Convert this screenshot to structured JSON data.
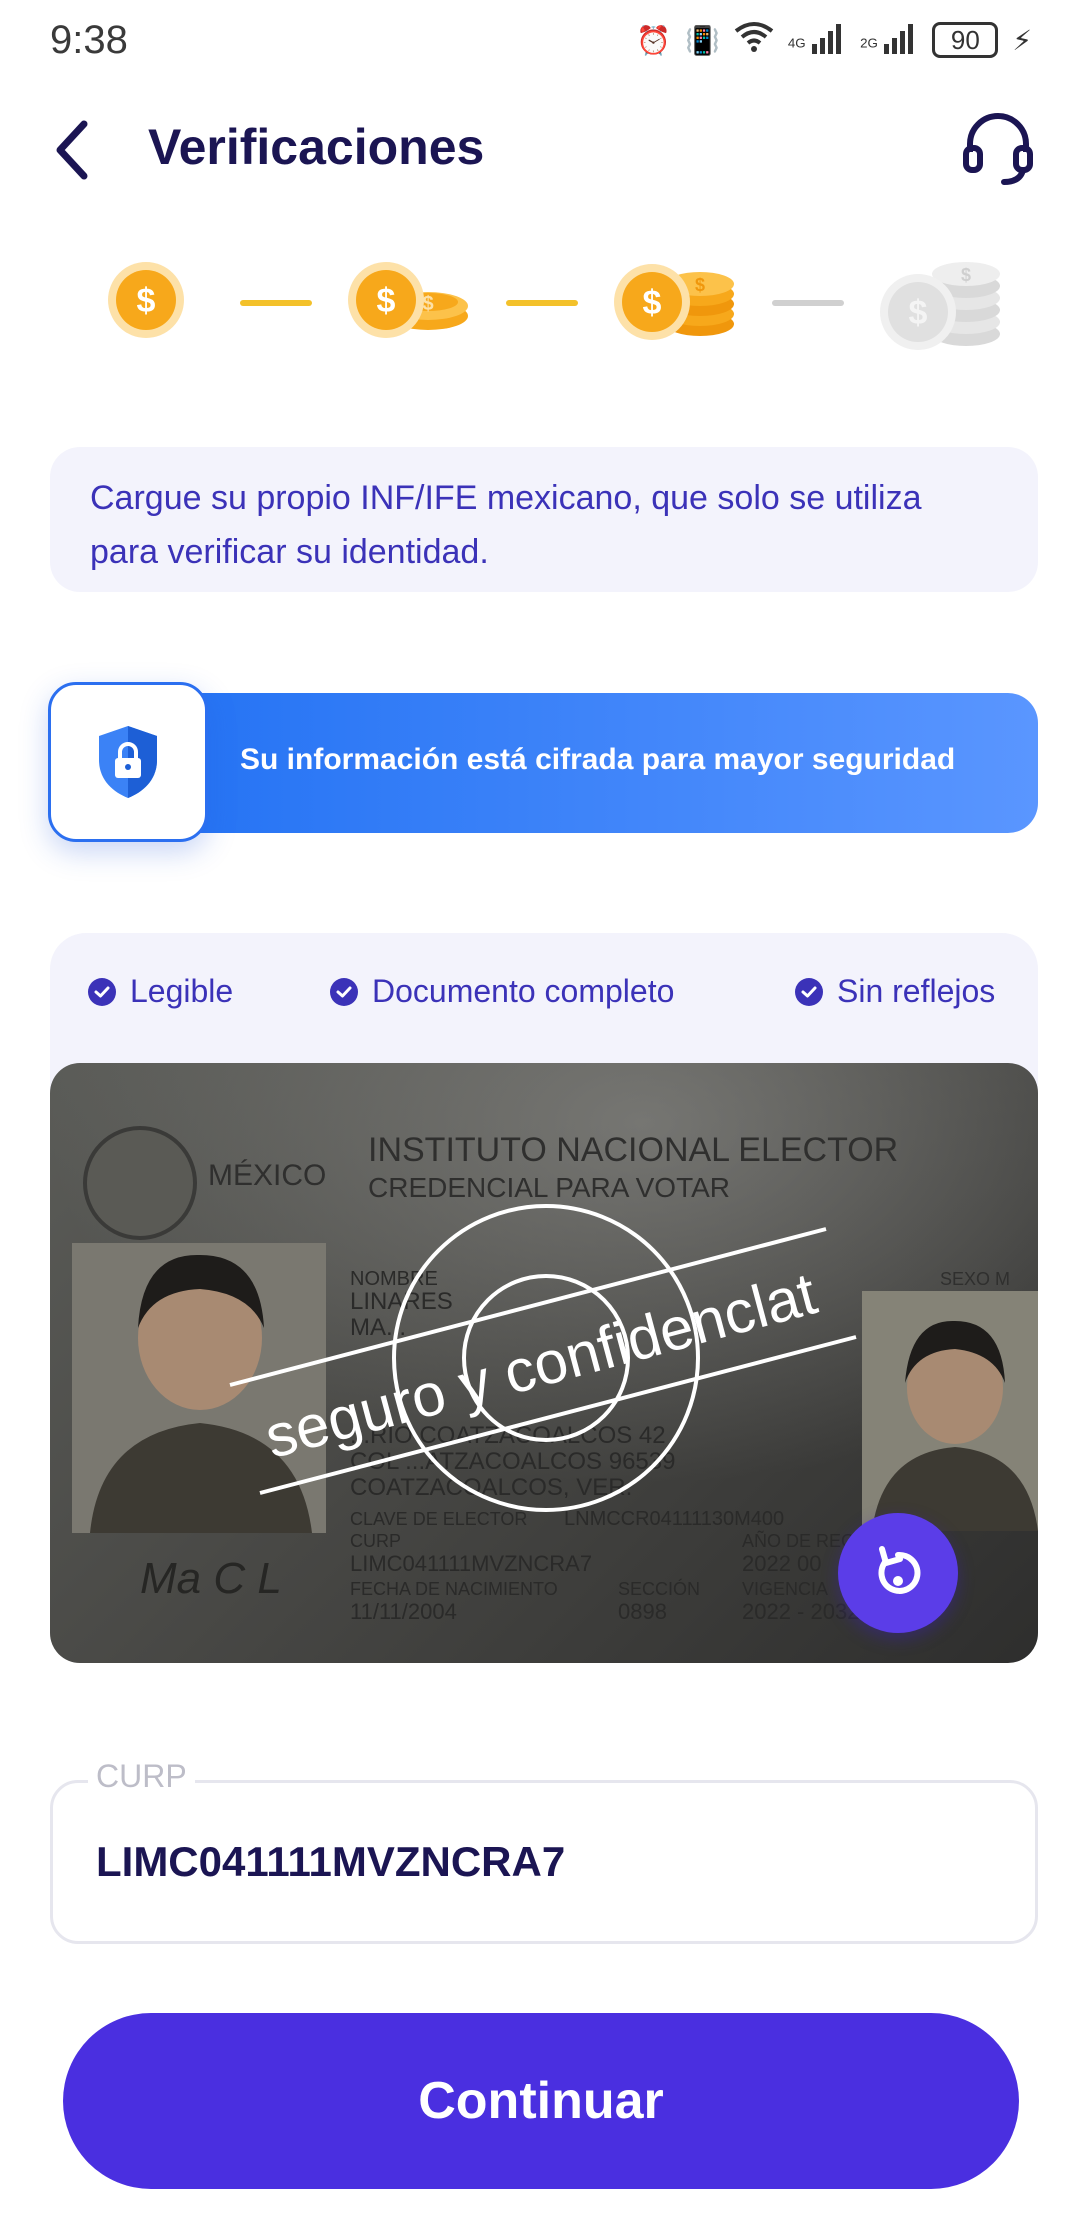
{
  "status_bar": {
    "time": "9:38",
    "battery": "90",
    "network_1": "4G",
    "network_2": "2G"
  },
  "header": {
    "title": "Verificaciones",
    "back_icon": "chevron-left-icon",
    "support_icon": "headset-icon"
  },
  "steps": [
    {
      "state": "done",
      "icon": "coin-single-icon"
    },
    {
      "state": "done",
      "icon": "coin-pair-icon"
    },
    {
      "state": "current",
      "icon": "coin-stack-icon"
    },
    {
      "state": "pending",
      "icon": "coin-stack-large-icon"
    }
  ],
  "info": {
    "text": "Cargue su propio INF/IFE mexicano, que solo se utiliza para verificar su identidad."
  },
  "secure": {
    "text": "Su información está cifrada para mayor seguridad",
    "icon": "shield-lock-icon"
  },
  "checks": {
    "legible": "Legible",
    "complete": "Documento completo",
    "no_glare": "Sin reflejos"
  },
  "id_card": {
    "watermark": "seguro y confidenclat",
    "country": "MÉXICO",
    "institute": "INSTITUTO NACIONAL ELECTOR",
    "credential": "CREDENCIAL PARA VOTAR",
    "nombre_label": "NOMBRE",
    "name_line_1": "LINARES",
    "name_line_2": "MA...",
    "address_1": "...RIO COATZACOALCOS 42",
    "address_2": "COL ...ATZACOALCOS 96539",
    "address_3": "COATZACOALCOS, VER.",
    "clave_label": "CLAVE DE ELECTOR",
    "clave_value": "LNMCCR04111130M400",
    "curp_label": "CURP",
    "curp_value": "LIMC041111MVZNCRA7",
    "birth_label": "FECHA DE NACIMIENTO",
    "birth_value": "11/11/2004",
    "section_label": "SECCIÓN",
    "section_value": "0898",
    "reg_label": "AÑO DE REGISTRO",
    "reg_value": "2022 00",
    "validity_label": "VIGENCIA",
    "validity_value": "2022 - 2032",
    "sex_label": "SEXO M",
    "signature": "Ma C L"
  },
  "curp_field": {
    "label": "CURP",
    "value": "LIMC041111MVZNCRA7"
  },
  "continue_label": "Continuar",
  "colors": {
    "primary": "#4a2fe0",
    "title": "#1b1553",
    "accent_blue": "#1d6ef2",
    "coin": "#f7a81b",
    "step_done": "#f3c12a",
    "step_pending": "#d0d0d0"
  }
}
